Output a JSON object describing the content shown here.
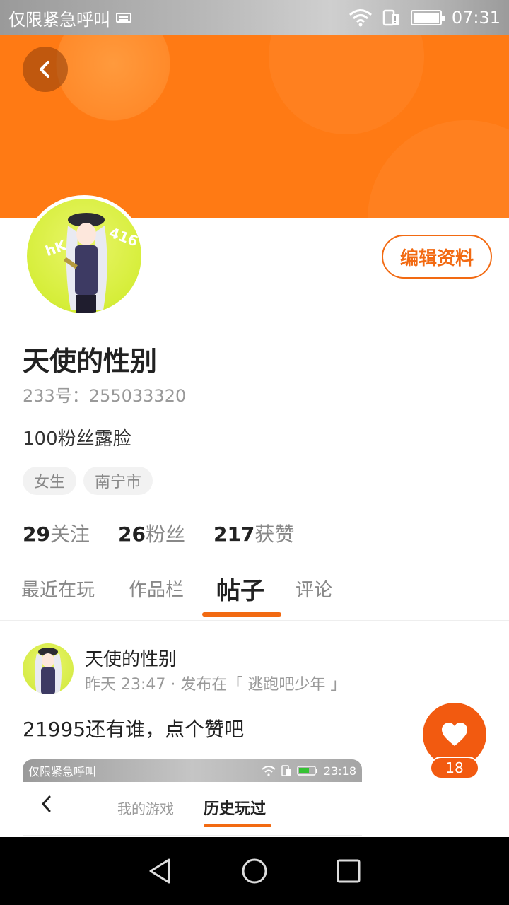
{
  "status_bar": {
    "carrier": "仅限紧急呼叫",
    "time": "07:31"
  },
  "profile": {
    "avatar_text_left": "hK",
    "avatar_text_right": "416",
    "edit_button": "编辑资料",
    "name": "天使的性别",
    "uid": "233号：255033320",
    "bio": "100粉丝露脸",
    "tags": [
      "女生",
      "南宁市"
    ],
    "stats": [
      {
        "num": "29",
        "label": "关注"
      },
      {
        "num": "26",
        "label": "粉丝"
      },
      {
        "num": "217",
        "label": "获赞"
      }
    ]
  },
  "tabs": [
    {
      "label": "最近在玩",
      "active": false
    },
    {
      "label": "作品栏",
      "active": false
    },
    {
      "label": "帖子",
      "active": true
    },
    {
      "label": "评论",
      "active": false
    }
  ],
  "post": {
    "author": "天使的性别",
    "meta": "昨天 23:47 · 发布在「 逃跑吧少年 」",
    "text": "21995还有谁，点个赞吧",
    "likes": "18",
    "embed": {
      "carrier": "仅限紧急呼叫",
      "time": "23:18",
      "tab_mygames": "我的游戏",
      "tab_history": "历史玩过"
    }
  }
}
